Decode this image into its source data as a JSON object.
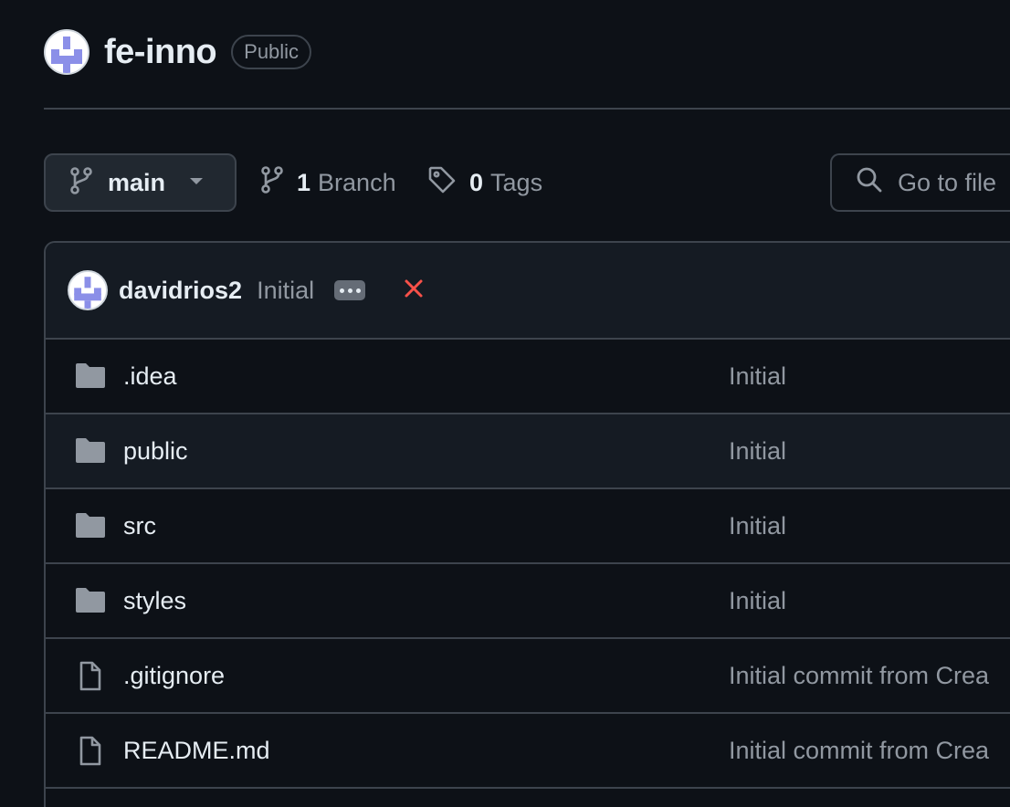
{
  "repo": {
    "name": "fe-inno",
    "visibility": "Public"
  },
  "toolbar": {
    "branch": "main",
    "branches_count": "1",
    "branches_label": "Branch",
    "tags_count": "0",
    "tags_label": "Tags",
    "goto_file_placeholder": "Go to file"
  },
  "latest_commit": {
    "author": "davidrios2",
    "message": "Initial"
  },
  "files": [
    {
      "name": ".idea",
      "type": "folder",
      "commit": "Initial"
    },
    {
      "name": "public",
      "type": "folder",
      "commit": "Initial"
    },
    {
      "name": "src",
      "type": "folder",
      "commit": "Initial"
    },
    {
      "name": "styles",
      "type": "folder",
      "commit": "Initial"
    },
    {
      "name": ".gitignore",
      "type": "file",
      "commit": "Initial commit from Crea"
    },
    {
      "name": "README.md",
      "type": "file",
      "commit": "Initial commit from Crea"
    }
  ],
  "colors": {
    "background": "#0d1117",
    "border": "#3d444d",
    "text_primary": "#e6edf3",
    "text_muted": "#9198a1",
    "status_fail": "#f85149",
    "avatar_accent": "#8b8fe8"
  }
}
